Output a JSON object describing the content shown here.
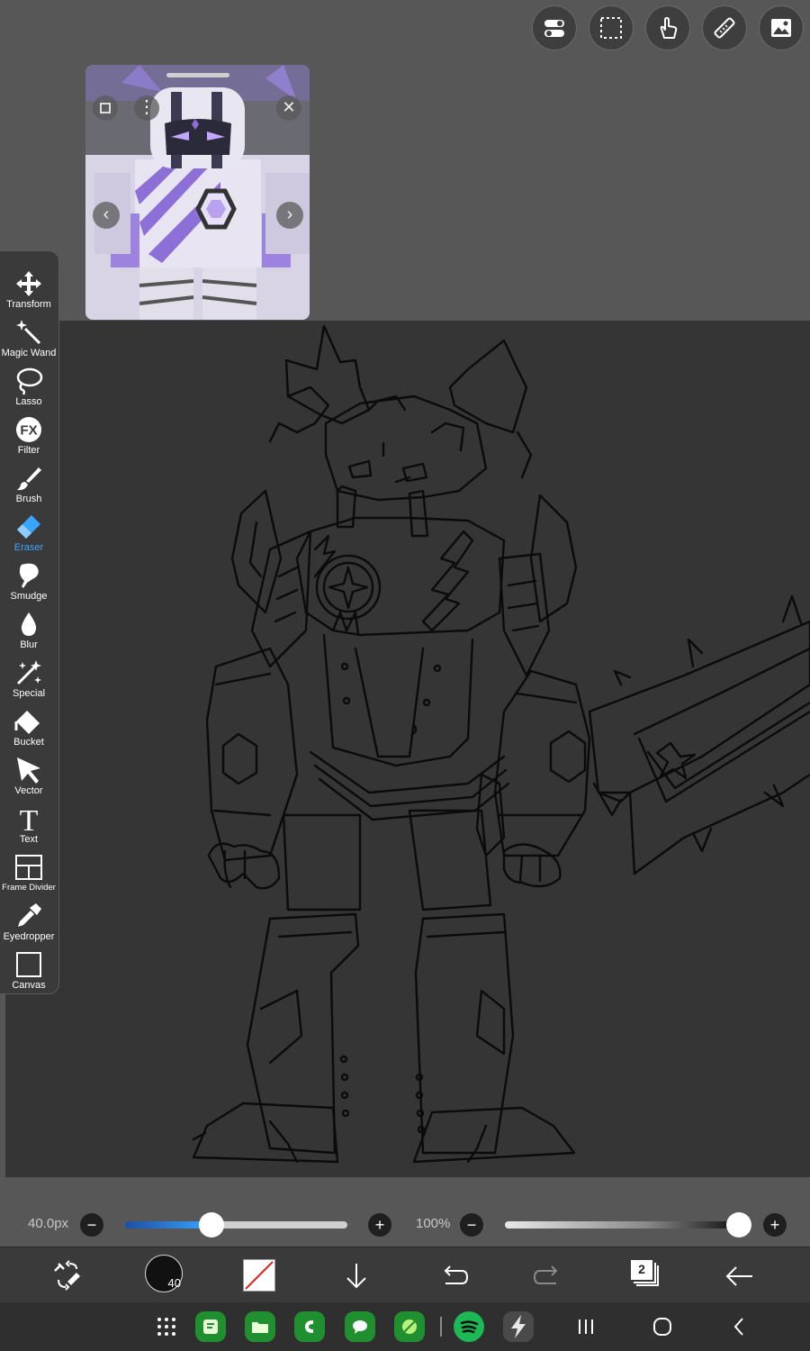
{
  "top_tools": [
    {
      "name": "layer-toggle-icon"
    },
    {
      "name": "selection-icon"
    },
    {
      "name": "touch-icon"
    },
    {
      "name": "ruler-icon"
    },
    {
      "name": "image-icon"
    }
  ],
  "toolbar": {
    "items": [
      {
        "label": "Transform",
        "icon": "transform-icon"
      },
      {
        "label": "Magic Wand",
        "icon": "magic-wand-icon"
      },
      {
        "label": "Lasso",
        "icon": "lasso-icon"
      },
      {
        "label": "Filter",
        "icon": "fx-icon",
        "glyph": "FX"
      },
      {
        "label": "Brush",
        "icon": "brush-icon"
      },
      {
        "label": "Eraser",
        "icon": "eraser-icon",
        "active": true
      },
      {
        "label": "Smudge",
        "icon": "smudge-icon"
      },
      {
        "label": "Blur",
        "icon": "blur-drop-icon"
      },
      {
        "label": "Special",
        "icon": "special-icon"
      },
      {
        "label": "Bucket",
        "icon": "bucket-icon"
      },
      {
        "label": "Vector",
        "icon": "vector-arrow-icon"
      },
      {
        "label": "Text",
        "icon": "text-icon",
        "glyph": "T"
      },
      {
        "label": "Frame Divider",
        "icon": "frame-divider-icon"
      },
      {
        "label": "Eyedropper",
        "icon": "eyedropper-icon"
      },
      {
        "label": "Canvas",
        "icon": "canvas-icon"
      }
    ]
  },
  "sliders": {
    "size": {
      "value": "40.0px",
      "fraction": 0.39
    },
    "opacity": {
      "value": "100%",
      "fraction": 1.0
    }
  },
  "actionbar": {
    "brush_size_label": "40",
    "layer_count": "2"
  },
  "colors": {
    "accent": "#3aa5ff",
    "canvas": "#353535",
    "background": "#575757"
  }
}
